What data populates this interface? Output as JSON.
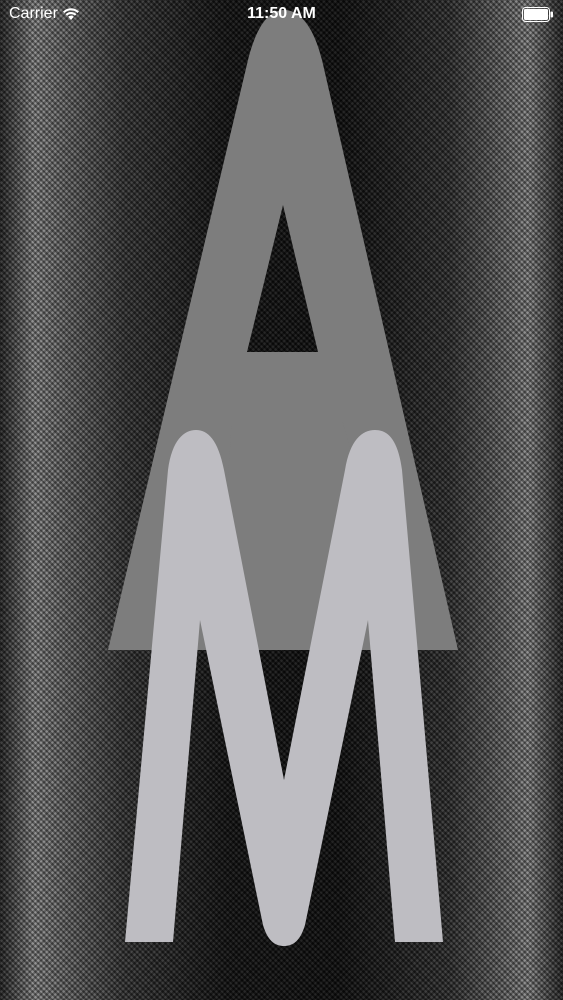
{
  "status_bar": {
    "carrier": "Carrier",
    "time": "11:50 AM",
    "wifi_icon": "wifi-icon",
    "battery_icon": "battery-full-icon",
    "text_color": "#ffffff"
  },
  "splash": {
    "logo_icon": "am-monogram-logo",
    "logo_letters": "AM",
    "colors": {
      "letter_a": "#7d7d7d",
      "letter_m": "#bebdc2"
    }
  }
}
